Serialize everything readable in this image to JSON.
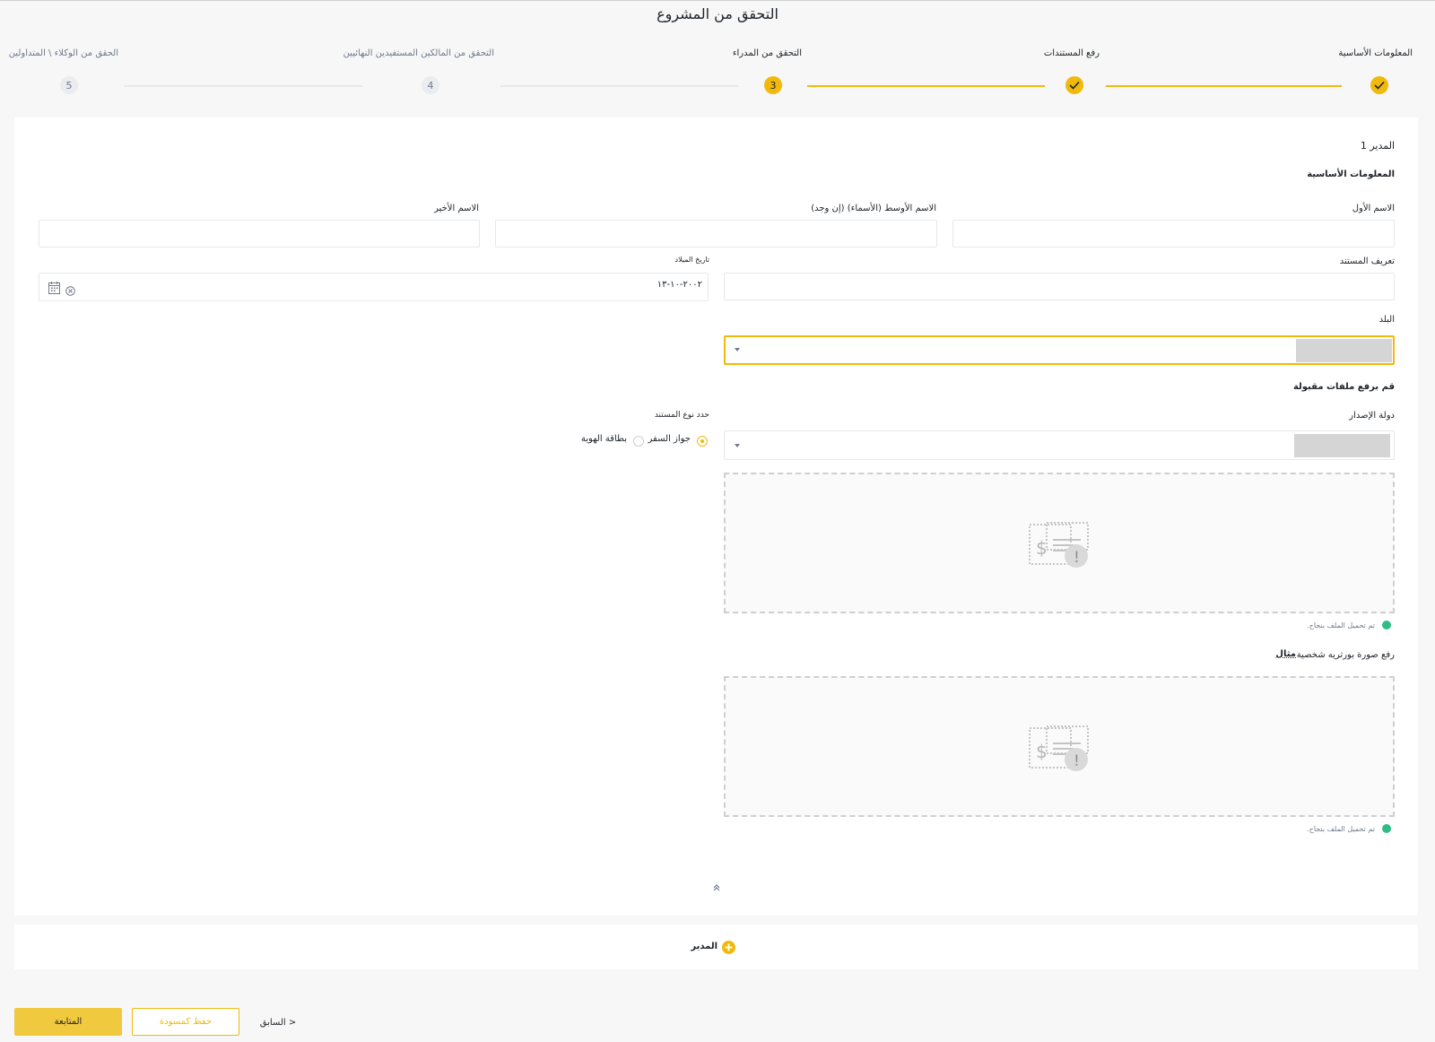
{
  "page": {
    "title": "التحقق من المشروع"
  },
  "stepper": {
    "steps": [
      {
        "label": "المعلومات الأساسية",
        "number": "1",
        "state": "done"
      },
      {
        "label": "رفع المستندات",
        "number": "2",
        "state": "done"
      },
      {
        "label": "التحقق من المدراء",
        "number": "3",
        "state": "active"
      },
      {
        "label": "التحقق من المالكين المستفيدين النهائيين",
        "number": "4",
        "state": "todo"
      },
      {
        "label": "الحقق من الوكلاء \\ المتداولين",
        "number": "5",
        "state": "todo"
      }
    ]
  },
  "director": {
    "heading": "المدير 1",
    "basic_info_heading": "المعلومات الأساسية",
    "first_name_label": "الاسم الأول",
    "middle_name_label": "الاسم الأوسط (الأسماء) (إن وجد)",
    "last_name_label": "الاسم الأخير",
    "document_id_label": "تعريف المستند",
    "dob_label": "تاريخ الميلاد",
    "dob_value": "٢٠٠٢-١٠-١٣",
    "country_label": "البلد",
    "upload_heading": "قم برفع ملفات مقبولة",
    "issuing_country_label": "دولة الإصدار",
    "doc_type_label": "حدد نوع المستند",
    "doc_type_options": [
      "جواز السفر",
      "بطاقة الهوية"
    ],
    "upload_success_text": "تم تحميل الملف بنجاح.",
    "portrait_label": "رفع صورة بورتريه شخصية",
    "example_link": "مثال"
  },
  "add_director": {
    "label": "المدير"
  },
  "footer": {
    "continue_label": "المتابعة",
    "save_draft_label": "حفظ كمسودة",
    "previous_label": "< السابق"
  },
  "colors": {
    "accent": "#f0b90b",
    "success": "#2ebd85",
    "muted": "#707a8a"
  }
}
